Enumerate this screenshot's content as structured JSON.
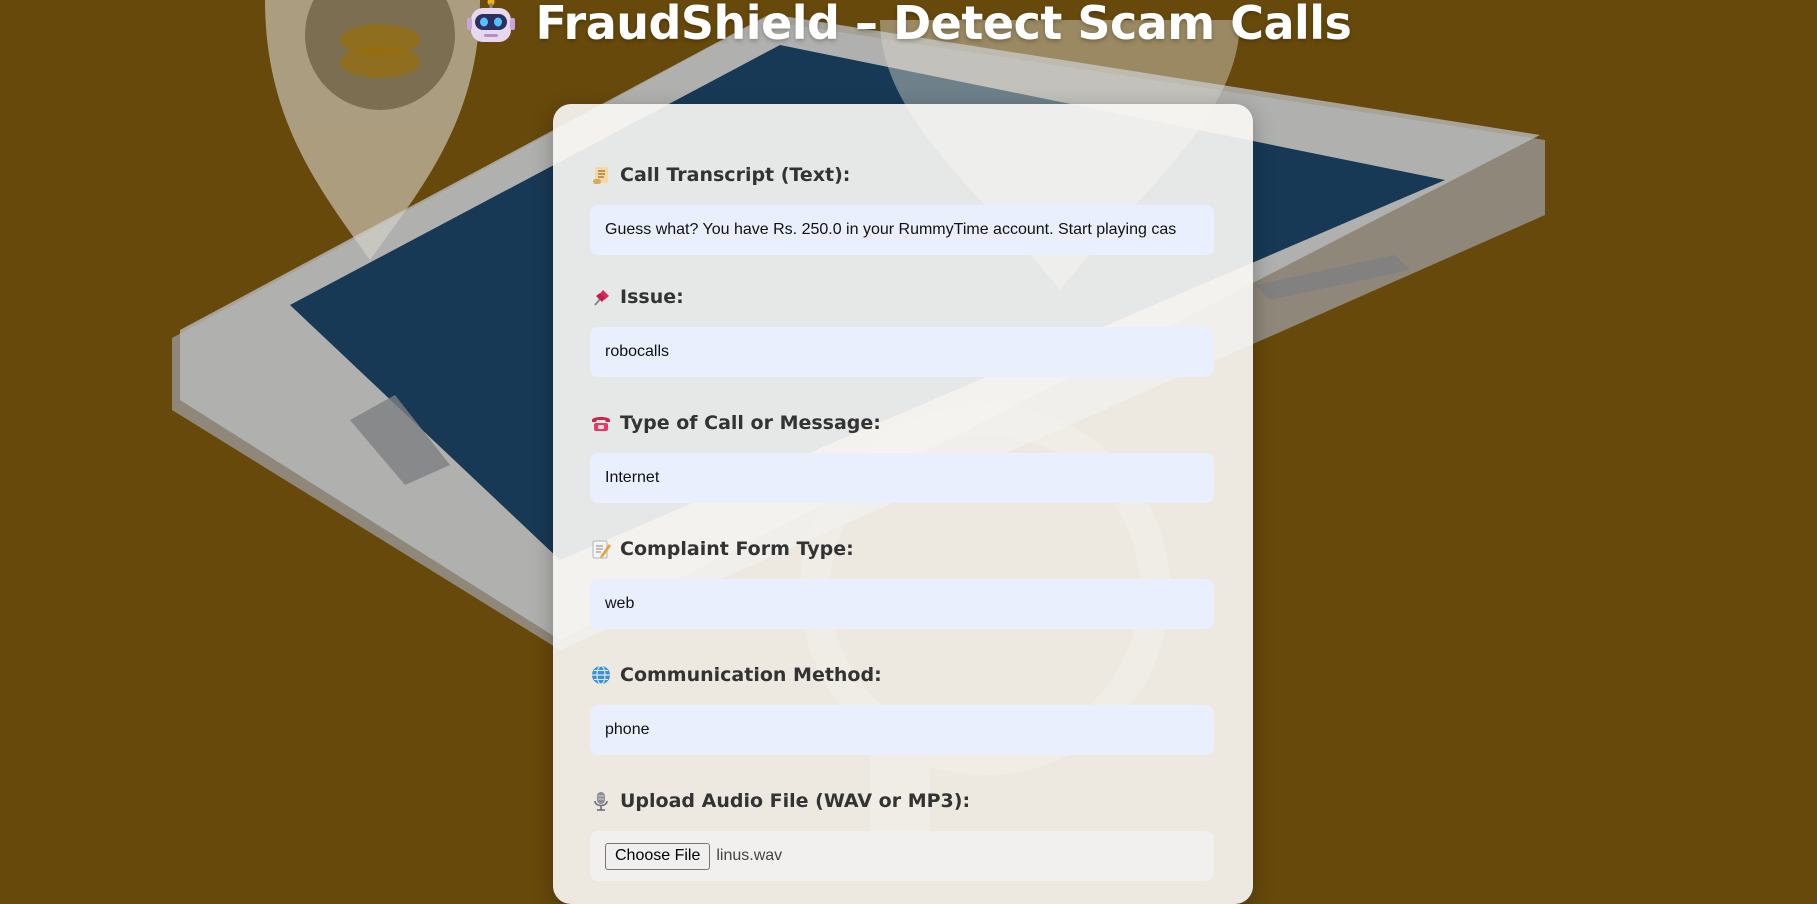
{
  "page": {
    "title": "FraudShield – Detect Scam Calls",
    "title_icon": "robot-icon",
    "accent_color": "#67490b"
  },
  "form": {
    "transcript": {
      "label": "Call Transcript (Text):",
      "icon": "scroll-icon",
      "value": "Guess what? You have Rs. 250.0 in your RummyTime account. Start playing cas"
    },
    "issue": {
      "label": "Issue:",
      "icon": "pushpin-icon",
      "value": "robocalls"
    },
    "call_type": {
      "label": "Type of Call or Message:",
      "icon": "telephone-icon",
      "value": "Internet"
    },
    "complaint_form": {
      "label": "Complaint Form Type:",
      "icon": "memo-icon",
      "value": "web"
    },
    "communication": {
      "label": "Communication Method:",
      "icon": "globe-icon",
      "value": "phone"
    },
    "audio_upload": {
      "label": "Upload Audio File (WAV or MP3):",
      "icon": "microphone-icon",
      "button_label": "Choose File",
      "file_name": "linus.wav"
    }
  }
}
